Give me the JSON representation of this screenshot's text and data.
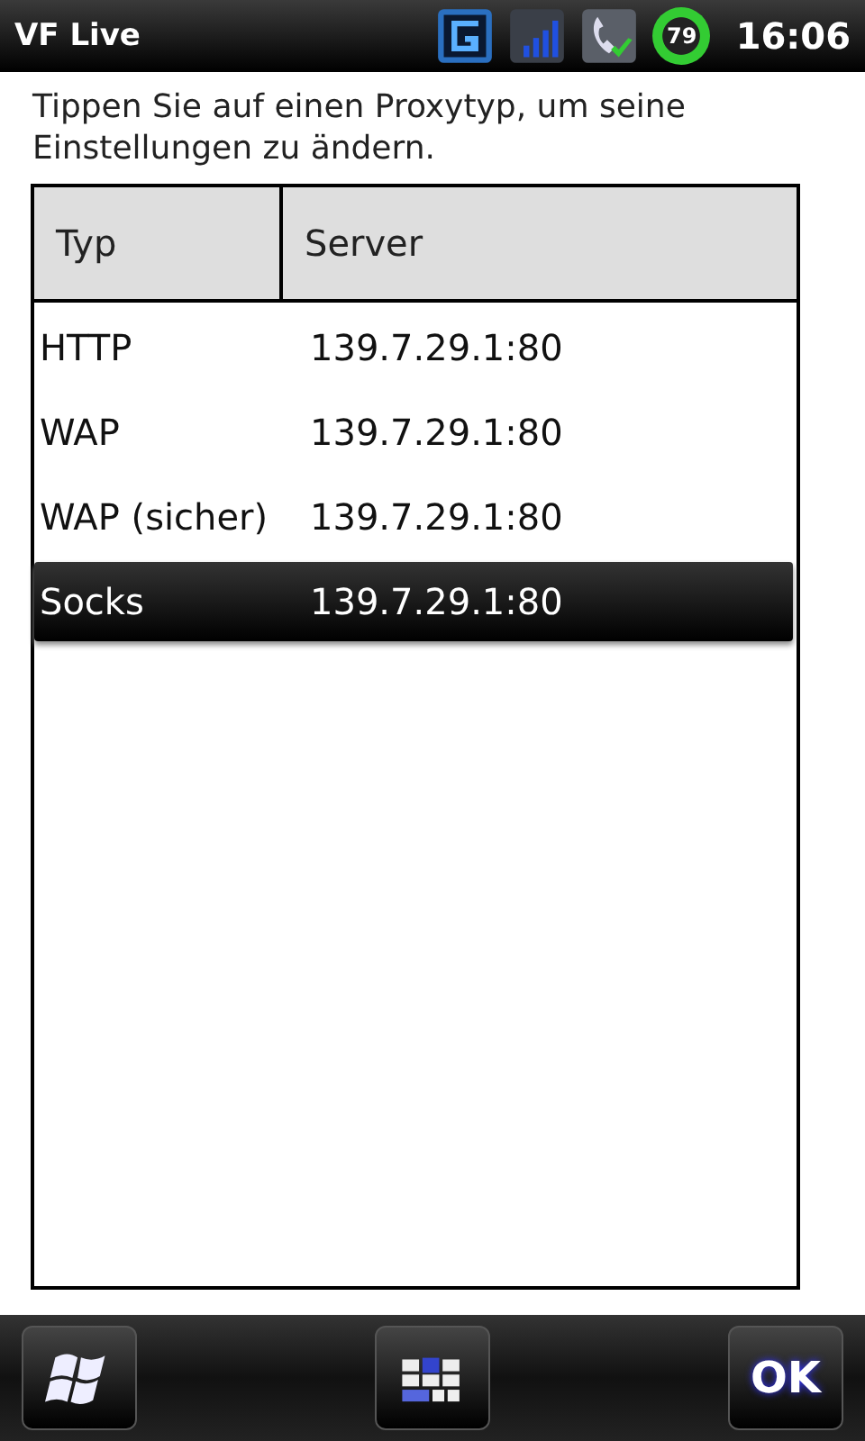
{
  "status_bar": {
    "title": "VF Live",
    "battery": "79",
    "time": "16:06"
  },
  "instruction": "Tippen Sie auf einen Proxytyp, um seine Einstellungen zu ändern.",
  "table": {
    "columns": [
      "Typ",
      "Server"
    ],
    "rows": [
      {
        "type": "HTTP",
        "server": "139.7.29.1:80",
        "selected": false
      },
      {
        "type": "WAP",
        "server": "139.7.29.1:80",
        "selected": false
      },
      {
        "type": "WAP (sicher)",
        "server": "139.7.29.1:80",
        "selected": false
      },
      {
        "type": "Socks",
        "server": "139.7.29.1:80",
        "selected": true
      }
    ]
  },
  "bottom_bar": {
    "ok": "OK"
  }
}
